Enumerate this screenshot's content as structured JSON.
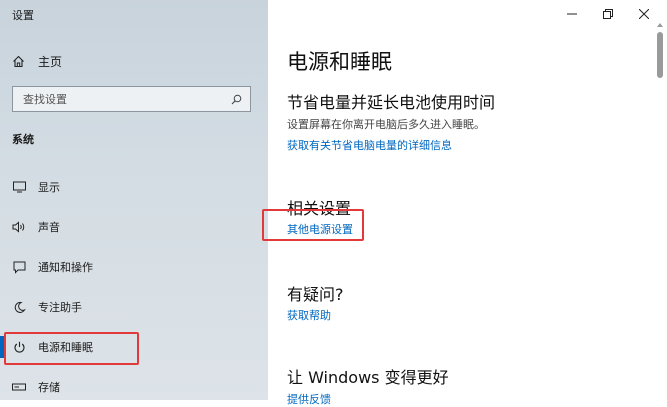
{
  "window": {
    "title": "设置"
  },
  "sidebar": {
    "home_label": "主页",
    "search_placeholder": "查找设置",
    "section_title": "系统",
    "items": [
      {
        "label": "显示",
        "icon": "monitor-icon"
      },
      {
        "label": "声音",
        "icon": "speaker-icon"
      },
      {
        "label": "通知和操作",
        "icon": "notification-icon"
      },
      {
        "label": "专注助手",
        "icon": "moon-icon"
      },
      {
        "label": "电源和睡眠",
        "icon": "power-icon",
        "active": true
      },
      {
        "label": "存储",
        "icon": "storage-icon"
      }
    ]
  },
  "main": {
    "page_title": "电源和睡眠",
    "save_power": {
      "heading": "节省电量并延长电池使用时间",
      "description": "设置屏幕在你离开电脑后多久进入睡眠。",
      "link": "获取有关节省电脑电量的详细信息"
    },
    "related": {
      "heading": "相关设置",
      "link": "其他电源设置"
    },
    "question": {
      "heading": "有疑问?",
      "link": "获取帮助"
    },
    "improve": {
      "heading": "让 Windows 变得更好",
      "link": "提供反馈"
    }
  },
  "colors": {
    "accent": "#0067c0",
    "highlight_box": "#e23a3a",
    "sidebar_bg": "#d3dce3"
  }
}
